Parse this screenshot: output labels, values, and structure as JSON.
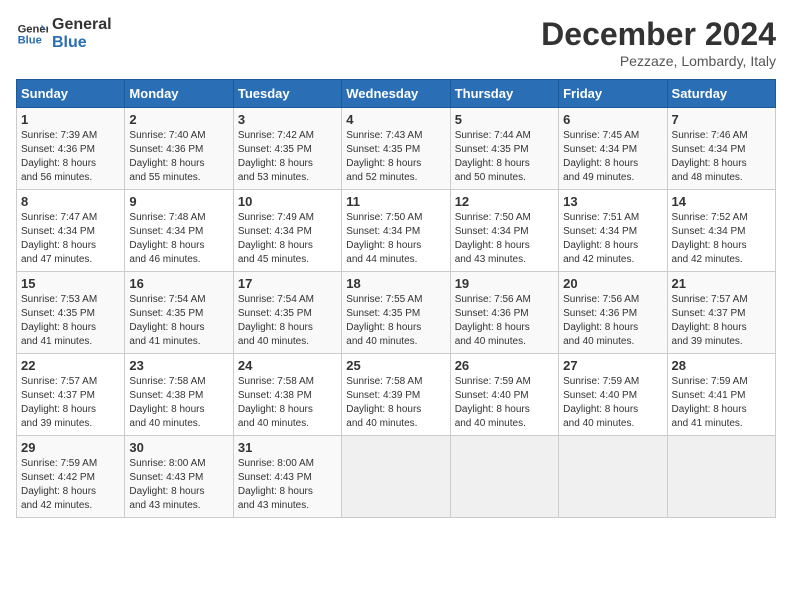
{
  "header": {
    "logo_line1": "General",
    "logo_line2": "Blue",
    "month": "December 2024",
    "location": "Pezzaze, Lombardy, Italy"
  },
  "weekdays": [
    "Sunday",
    "Monday",
    "Tuesday",
    "Wednesday",
    "Thursday",
    "Friday",
    "Saturday"
  ],
  "weeks": [
    [
      {
        "day": "1",
        "info": "Sunrise: 7:39 AM\nSunset: 4:36 PM\nDaylight: 8 hours\nand 56 minutes."
      },
      {
        "day": "2",
        "info": "Sunrise: 7:40 AM\nSunset: 4:36 PM\nDaylight: 8 hours\nand 55 minutes."
      },
      {
        "day": "3",
        "info": "Sunrise: 7:42 AM\nSunset: 4:35 PM\nDaylight: 8 hours\nand 53 minutes."
      },
      {
        "day": "4",
        "info": "Sunrise: 7:43 AM\nSunset: 4:35 PM\nDaylight: 8 hours\nand 52 minutes."
      },
      {
        "day": "5",
        "info": "Sunrise: 7:44 AM\nSunset: 4:35 PM\nDaylight: 8 hours\nand 50 minutes."
      },
      {
        "day": "6",
        "info": "Sunrise: 7:45 AM\nSunset: 4:34 PM\nDaylight: 8 hours\nand 49 minutes."
      },
      {
        "day": "7",
        "info": "Sunrise: 7:46 AM\nSunset: 4:34 PM\nDaylight: 8 hours\nand 48 minutes."
      }
    ],
    [
      {
        "day": "8",
        "info": "Sunrise: 7:47 AM\nSunset: 4:34 PM\nDaylight: 8 hours\nand 47 minutes."
      },
      {
        "day": "9",
        "info": "Sunrise: 7:48 AM\nSunset: 4:34 PM\nDaylight: 8 hours\nand 46 minutes."
      },
      {
        "day": "10",
        "info": "Sunrise: 7:49 AM\nSunset: 4:34 PM\nDaylight: 8 hours\nand 45 minutes."
      },
      {
        "day": "11",
        "info": "Sunrise: 7:50 AM\nSunset: 4:34 PM\nDaylight: 8 hours\nand 44 minutes."
      },
      {
        "day": "12",
        "info": "Sunrise: 7:50 AM\nSunset: 4:34 PM\nDaylight: 8 hours\nand 43 minutes."
      },
      {
        "day": "13",
        "info": "Sunrise: 7:51 AM\nSunset: 4:34 PM\nDaylight: 8 hours\nand 42 minutes."
      },
      {
        "day": "14",
        "info": "Sunrise: 7:52 AM\nSunset: 4:34 PM\nDaylight: 8 hours\nand 42 minutes."
      }
    ],
    [
      {
        "day": "15",
        "info": "Sunrise: 7:53 AM\nSunset: 4:35 PM\nDaylight: 8 hours\nand 41 minutes."
      },
      {
        "day": "16",
        "info": "Sunrise: 7:54 AM\nSunset: 4:35 PM\nDaylight: 8 hours\nand 41 minutes."
      },
      {
        "day": "17",
        "info": "Sunrise: 7:54 AM\nSunset: 4:35 PM\nDaylight: 8 hours\nand 40 minutes."
      },
      {
        "day": "18",
        "info": "Sunrise: 7:55 AM\nSunset: 4:35 PM\nDaylight: 8 hours\nand 40 minutes."
      },
      {
        "day": "19",
        "info": "Sunrise: 7:56 AM\nSunset: 4:36 PM\nDaylight: 8 hours\nand 40 minutes."
      },
      {
        "day": "20",
        "info": "Sunrise: 7:56 AM\nSunset: 4:36 PM\nDaylight: 8 hours\nand 40 minutes."
      },
      {
        "day": "21",
        "info": "Sunrise: 7:57 AM\nSunset: 4:37 PM\nDaylight: 8 hours\nand 39 minutes."
      }
    ],
    [
      {
        "day": "22",
        "info": "Sunrise: 7:57 AM\nSunset: 4:37 PM\nDaylight: 8 hours\nand 39 minutes."
      },
      {
        "day": "23",
        "info": "Sunrise: 7:58 AM\nSunset: 4:38 PM\nDaylight: 8 hours\nand 40 minutes."
      },
      {
        "day": "24",
        "info": "Sunrise: 7:58 AM\nSunset: 4:38 PM\nDaylight: 8 hours\nand 40 minutes."
      },
      {
        "day": "25",
        "info": "Sunrise: 7:58 AM\nSunset: 4:39 PM\nDaylight: 8 hours\nand 40 minutes."
      },
      {
        "day": "26",
        "info": "Sunrise: 7:59 AM\nSunset: 4:40 PM\nDaylight: 8 hours\nand 40 minutes."
      },
      {
        "day": "27",
        "info": "Sunrise: 7:59 AM\nSunset: 4:40 PM\nDaylight: 8 hours\nand 40 minutes."
      },
      {
        "day": "28",
        "info": "Sunrise: 7:59 AM\nSunset: 4:41 PM\nDaylight: 8 hours\nand 41 minutes."
      }
    ],
    [
      {
        "day": "29",
        "info": "Sunrise: 7:59 AM\nSunset: 4:42 PM\nDaylight: 8 hours\nand 42 minutes."
      },
      {
        "day": "30",
        "info": "Sunrise: 8:00 AM\nSunset: 4:43 PM\nDaylight: 8 hours\nand 43 minutes."
      },
      {
        "day": "31",
        "info": "Sunrise: 8:00 AM\nSunset: 4:43 PM\nDaylight: 8 hours\nand 43 minutes."
      },
      {
        "day": "",
        "info": ""
      },
      {
        "day": "",
        "info": ""
      },
      {
        "day": "",
        "info": ""
      },
      {
        "day": "",
        "info": ""
      }
    ]
  ]
}
